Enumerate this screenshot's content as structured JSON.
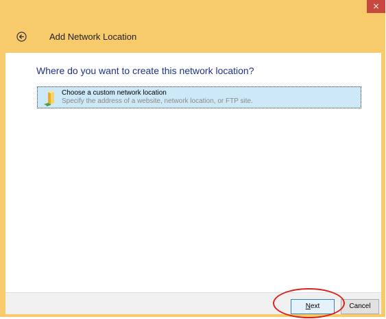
{
  "window": {
    "close_glyph": "×",
    "header_title": "Add Network Location",
    "back_icon": "back-arrow-icon"
  },
  "content": {
    "question": "Where do you want to create this network location?",
    "option": {
      "title": "Choose a custom network location",
      "description": "Specify the address of a website, network location, or FTP site.",
      "icon": "folder-network-icon"
    }
  },
  "footer": {
    "next_label_access_key": "N",
    "next_label_rest": "ext",
    "cancel_label": "Cancel"
  },
  "colors": {
    "title_bar": "#f7ca6c",
    "close_button": "#c7483f",
    "question_text": "#1e3287",
    "option_selected": "#cde8f7",
    "annotation": "#d9221c"
  }
}
